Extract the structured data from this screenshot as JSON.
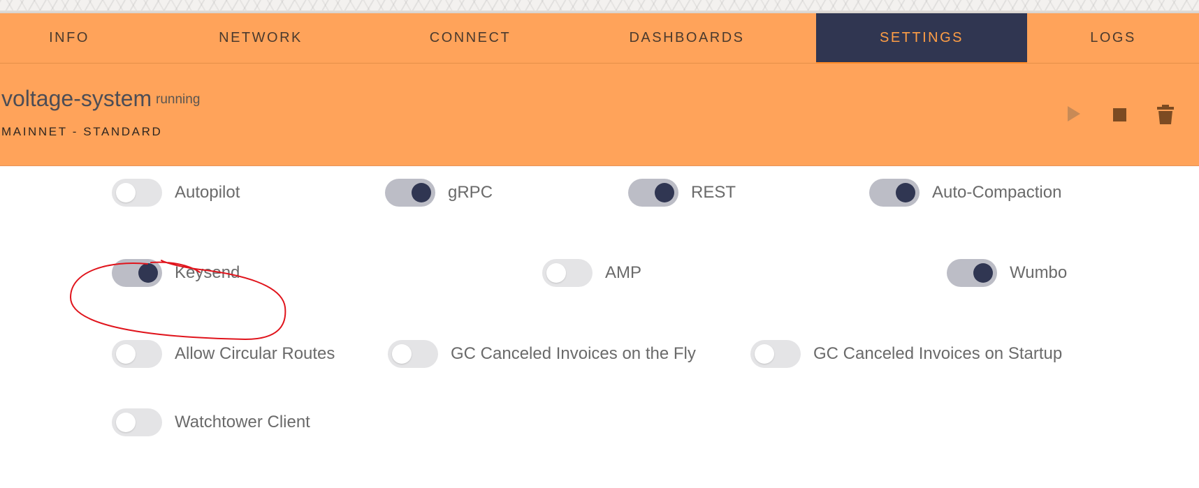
{
  "tabs": [
    {
      "label": "INFO",
      "active": false
    },
    {
      "label": "NETWORK",
      "active": false
    },
    {
      "label": "CONNECT",
      "active": false
    },
    {
      "label": "DASHBOARDS",
      "active": false
    },
    {
      "label": "SETTINGS",
      "active": true
    },
    {
      "label": "LOGS",
      "active": false
    }
  ],
  "node": {
    "name": "voltage-system",
    "status": "running",
    "network": "MAINNET - STANDARD",
    "controls": [
      "play-icon",
      "stop-icon",
      "trash-icon"
    ]
  },
  "settings": [
    {
      "label": "Autopilot",
      "enabled": false
    },
    {
      "label": "gRPC",
      "enabled": true
    },
    {
      "label": "REST",
      "enabled": true
    },
    {
      "label": "Auto-Compaction",
      "enabled": true
    },
    {
      "label": "Keysend",
      "enabled": true
    },
    {
      "label": "AMP",
      "enabled": false
    },
    {
      "label": "Wumbo",
      "enabled": true
    },
    {
      "label": "Allow Circular Routes",
      "enabled": false
    },
    {
      "label": "GC Canceled Invoices on the Fly",
      "enabled": false
    },
    {
      "label": "GC Canceled Invoices on Startup",
      "enabled": false
    },
    {
      "label": "Watchtower Client",
      "enabled": false
    }
  ],
  "colors": {
    "header_bg": "#ffa35a",
    "active_tab_bg": "#303651",
    "active_tab_text": "#ff9e45",
    "switch_on_track": "#bcbdc6",
    "switch_on_knob": "#303652",
    "switch_off_track": "#e4e4e6",
    "annotation": "#e0141c"
  }
}
